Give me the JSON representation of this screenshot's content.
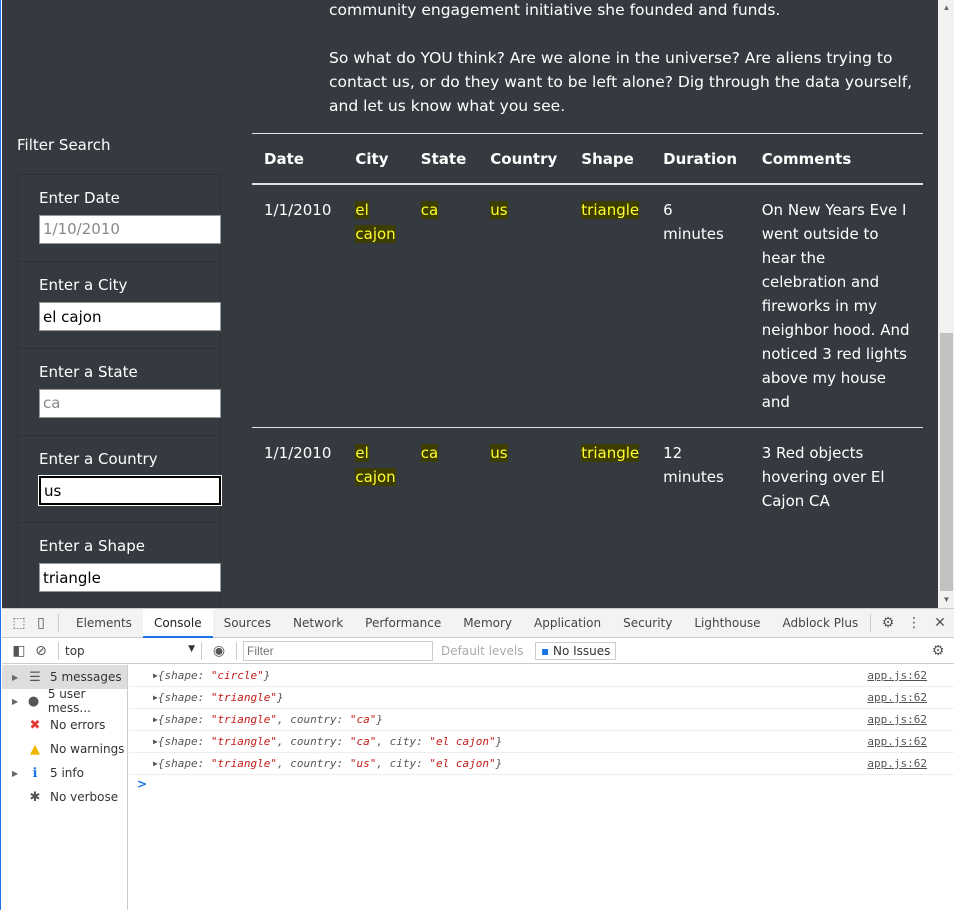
{
  "intro": {
    "line1": "community engagement initiative she founded and funds.",
    "paragraph": "So what do YOU think? Are we alone in the universe? Are aliens trying to contact us, or do they want to be left alone? Dig through the data yourself, and let us know what you see."
  },
  "filter": {
    "title": "Filter Search",
    "fields": [
      {
        "label": "Enter Date",
        "value": "",
        "placeholder": "1/10/2010"
      },
      {
        "label": "Enter a City",
        "value": "el cajon",
        "placeholder": ""
      },
      {
        "label": "Enter a State",
        "value": "",
        "placeholder": "ca"
      },
      {
        "label": "Enter a Country",
        "value": "us",
        "placeholder": ""
      },
      {
        "label": "Enter a Shape",
        "value": "triangle",
        "placeholder": ""
      }
    ]
  },
  "table": {
    "headers": [
      "Date",
      "City",
      "State",
      "Country",
      "Shape",
      "Duration",
      "Comments"
    ],
    "rows": [
      [
        "1/1/2010",
        "el cajon",
        "ca",
        "us",
        "triangle",
        "6 minutes",
        "On New Years Eve I went outside to hear the celebration and fireworks in my neighbor hood. And noticed 3 red lights above my house and"
      ],
      [
        "1/1/2010",
        "el cajon",
        "ca",
        "us",
        "triangle",
        "12 minutes",
        "3 Red objects hovering over El Cajon CA"
      ]
    ]
  },
  "devtools": {
    "tabs": [
      "Elements",
      "Console",
      "Sources",
      "Network",
      "Performance",
      "Memory",
      "Application",
      "Security",
      "Lighthouse",
      "Adblock Plus"
    ],
    "active_tab": "Console",
    "context": "top",
    "filter_placeholder": "Filter",
    "levels": "Default levels",
    "issues": "No Issues",
    "sidebar": [
      {
        "label": "5 messages",
        "icon": "list-icon"
      },
      {
        "label": "5 user mess...",
        "icon": "user-icon"
      },
      {
        "label": "No errors",
        "icon": "error-icon"
      },
      {
        "label": "No warnings",
        "icon": "warning-icon"
      },
      {
        "label": "5 info",
        "icon": "info-icon"
      },
      {
        "label": "No verbose",
        "icon": "bug-icon"
      }
    ],
    "logs": [
      {
        "text": "{shape: \"circle\"}",
        "source": "app.js:62"
      },
      {
        "text": "{shape: \"triangle\"}",
        "source": "app.js:62"
      },
      {
        "text": "{shape: \"triangle\", country: \"ca\"}",
        "source": "app.js:62"
      },
      {
        "text": "{shape: \"triangle\", country: \"ca\", city: \"el cajon\"}",
        "source": "app.js:62"
      },
      {
        "text": "{shape: \"triangle\", country: \"us\", city: \"el cajon\"}",
        "source": "app.js:62"
      }
    ],
    "prompt": ">"
  }
}
